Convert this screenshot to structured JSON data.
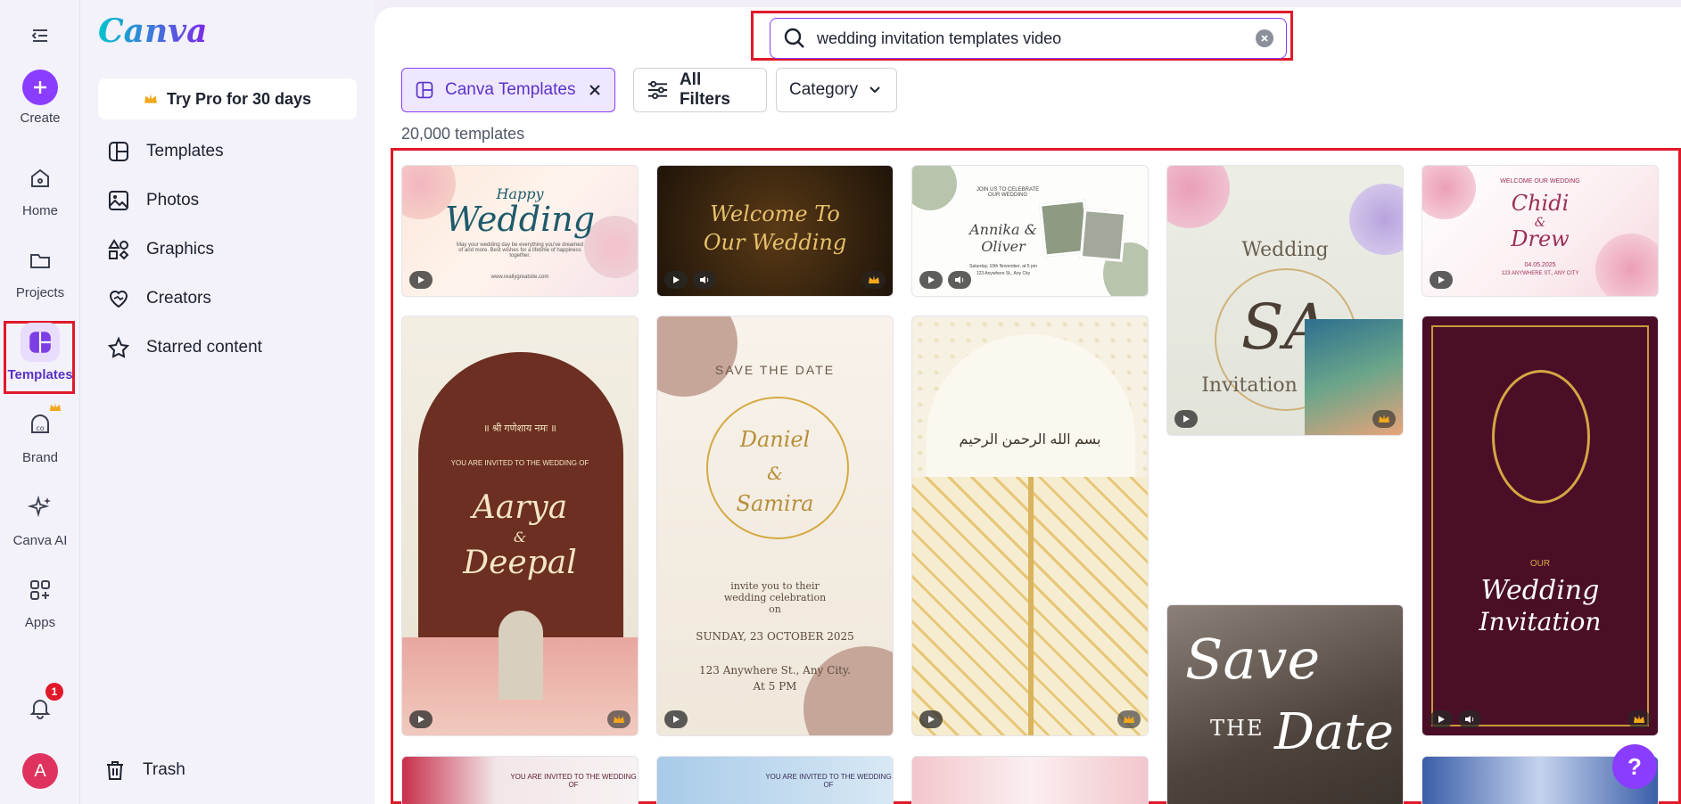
{
  "rail": {
    "create_label": "Create",
    "home_label": "Home",
    "projects_label": "Projects",
    "templates_label": "Templates",
    "brand_label": "Brand",
    "canva_ai_label": "Canva AI",
    "apps_label": "Apps",
    "notification_count": "1",
    "avatar_initial": "A"
  },
  "sidebar": {
    "logo": "Canva",
    "try_pro": "Try Pro for 30 days",
    "items": [
      {
        "label": "Templates",
        "icon": "templates-icon"
      },
      {
        "label": "Photos",
        "icon": "photos-icon"
      },
      {
        "label": "Graphics",
        "icon": "graphics-icon"
      },
      {
        "label": "Creators",
        "icon": "creators-icon"
      },
      {
        "label": "Starred content",
        "icon": "star-icon"
      }
    ],
    "trash": "Trash"
  },
  "search": {
    "value": "wedding invitation templates video"
  },
  "filters": {
    "templates_chip": "Canva Templates",
    "all_filters": "All Filters",
    "category": "Category"
  },
  "results": {
    "count": "20,000 templates"
  },
  "tiles": {
    "t1_top": "Happy",
    "t1_main": "Wedding",
    "t1_sub": "May your wedding day be everything you've dreamed of and more. Best wishes for a lifetime of happiness together.",
    "t1_url": "www.reallygreatsite.com",
    "t2_main1": "Welcome To",
    "t2_main2": "Our Wedding",
    "t3_top": "JOIN US TO CELEBRATE OUR WEDDING",
    "t3_names": "Annika & Oliver",
    "t3_date": "Saturday, 10th November, at 5 pm",
    "t3_addr": "123 Anywhere St., Any City",
    "t4_top": "Wedding",
    "t4_mono": "SA",
    "t4_bottom": "Invitation",
    "t5_top": "WELCOME OUR WEDDING",
    "t5_name1": "Chidi",
    "t5_amp": "&",
    "t5_name2": "Drew",
    "t5_date": "04.05.2025",
    "t5_addr": "123 ANYWHERE ST., ANY CITY",
    "t6_hindi": "॥ श्री गणेशाय नमः ॥",
    "t6_invite": "YOU ARE INVITED TO THE WEDDING OF",
    "t6_name1": "Aarya",
    "t6_amp": "&",
    "t6_name2": "Deepal",
    "t7_top": "SAVE THE DATE",
    "t7_name1": "Daniel",
    "t7_amp": "&",
    "t7_name2": "Samira",
    "t7_invite": "invite you to their wedding celebration on",
    "t7_date": "SUNDAY, 23 OCTOBER 2025",
    "t7_addr": "123 Anywhere St., Any City.",
    "t7_time": "At 5 PM",
    "t8_arabic": "بسم الله الرحمن الرحيم",
    "t9_line1": "Save",
    "t9_line2": "THE",
    "t9_line3": "Date",
    "t10_our": "OUR",
    "t10_line1": "Wedding",
    "t10_line2": "Invitation",
    "t11_invite": "YOU ARE INVITED TO THE WEDDING OF",
    "t12_invite": "YOU ARE INVITED TO THE WEDDING OF"
  },
  "help_label": "?",
  "colors": {
    "accent": "#8b3dff",
    "highlight": "#e0192a"
  }
}
